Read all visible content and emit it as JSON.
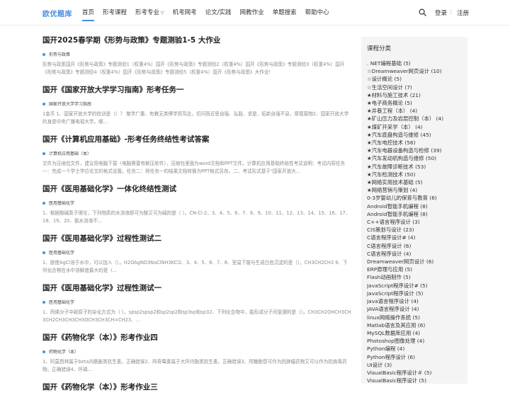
{
  "header": {
    "logo": "欧优题库",
    "nav": [
      {
        "label": "首页",
        "active": true,
        "caret": false
      },
      {
        "label": "形考课程",
        "active": false,
        "caret": false
      },
      {
        "label": "形考专业",
        "active": false,
        "caret": true
      },
      {
        "label": "机考网考",
        "active": false,
        "caret": false
      },
      {
        "label": "论文/实践",
        "active": false,
        "caret": false
      },
      {
        "label": "网教作业",
        "active": false,
        "caret": false
      },
      {
        "label": "单题搜索",
        "active": false,
        "caret": false
      },
      {
        "label": "帮助中心",
        "active": false,
        "caret": false
      }
    ],
    "login": "登录",
    "separator": "|",
    "register": "注册",
    "accent_color": "#4a8de0"
  },
  "articles": [
    {
      "title": "国开2025春学期《形势与政策》专题测验1-5 大作业",
      "category": "形势与政策",
      "excerpt": "形势与政策国开《形势与政策》专题测验1（权重4%）国开《形势与政策》专题测验2（权重4%）国开《形势与政策》专题测验3（权重4%）国开《形势与政策》专题测验4（权重4%）国开《形势与政策》专题测验5（权重4%）国开《形势与政策》大作业!"
    },
    {
      "title": "国开《国家开放大学学习指南》形考任务一",
      "category": "国家开放大学学习指南",
      "excerpt": "1金币 1、国家开放大学的校训是（）？ 敬学广惠、有教无类博学而笃志，切问而近思自强、弘毅、求是、拓新自强不息，厚德载物2、国家开放大学的身是中央广播电视大学。哪..."
    },
    {
      "title": "国开《计算机应用基础》-形考任务终结性考试答案",
      "category": "计算机应用基础（本）",
      "excerpt": "文件为压缩包文件，建议用电脑下载（电脑需要有解压软件），压缩包里面为word文档和PPT文件。计算机应用基础终结性考试说明：考试内容任务一：完成一个学士学位论文的格式设置。任务二：将任务一的结果文档转换为PPT格式另存。二、考试形式基于\"国家开放大..."
    },
    {
      "title": "国开《医用基础化学》一体化终结性测试",
      "category": "医用基础化学",
      "excerpt": "1、根据酸碱质子理论，下列物质的水溶液即可为酸又可为碱的是（ ）。CN-Cl-2、3、4、5、6、7、8、9、10、11、12、13、14、15、16、17、18、19、20、氨水溶液不..."
    },
    {
      "title": "国开《医用基础化学》过程性测试二",
      "category": "医用基础化学",
      "excerpt": "1、欲使AgCl溶于水中，可以加入（）。H2OAgNO3NaClNH3KCl2、3、4、5、6、7、8、室温下能与生成白色沉淀的是（）。CH3CH2CH3 9、下列化合物在水中溶解度最大的是（..."
    },
    {
      "title": "国开《医用基础化学》过程性测试一",
      "category": "医用基础化学",
      "excerpt": "1、丙烯分子中碳原子的杂化方式为（ ）。spsp2spsp2和sp2sp2和sp3sp和sp32、下列化合物中，能形成分子间氢键的是（）。CH3CH2OHCH3CH3CH2CH3CH3CH3OCH3CH3CH=CH23、..."
    },
    {
      "title": "国开《药物化学（本）》形考作业四",
      "category": "药物化学（本）",
      "excerpt": "1、阿莫西林属于beta内酰胺类抗生素。正确错误2、阿奇霉素属于大环内酯类抗生素。正确错误3、阿糖胞苷可作为抗肿瘤药物又可以作为抗病毒药物。正确错误4、环磷..."
    },
    {
      "title": "国开《药物化学（本）》形考作业三",
      "category": "",
      "excerpt": ""
    }
  ],
  "sidebar": {
    "title": "课程分类",
    "items": [
      ". NET编程基础 (5)",
      "☆Dreamweaver网页设计 (10)",
      "☆设计概论 (5)",
      "☆生活空间设计 (7)",
      "★材料与施工技术 (21)",
      "★电子商务概论 (5)",
      "★井巷工程（本） (4)",
      "★矿山压力及岩层控制（本） (4)",
      "★煤矿开采学（本） (4)",
      "★汽车底盘构造与维修 (45)",
      "★汽车电控技术 (56)",
      "★汽车电器设备构造与检修 (39)",
      "★汽车发动机构造与维修 (50)",
      "★汽车故障诊断技术 (53)",
      "★汽车检测技术 (50)",
      "★网络实用技术基础 (5)",
      "★网络营销与策划 (4)",
      "0-3岁婴幼儿的保育与教育 (6)",
      "Android智能手机编程 (8)",
      "Android智能手机编程 (8)",
      "C++语言程序设计 (3)",
      "CIS策划与设计 (23)",
      "C语言程序设计# (4)",
      "C语言程序设计 (6)",
      "C语言程序设计 (4)",
      "Dreamweaver网页设计 (6)",
      "ERP原理与应用 (5)",
      "Flash动画制作 (5)",
      "JavaScript程序设计# (5)",
      "JavaScript程序设计 (5)",
      "Java语言程序设计 (4)",
      "JAVA语言程序设计 (4)",
      "linux网络操作系统 (5)",
      "Matlab语言及其应用 (6)",
      "MySQL数据库应用 (4)",
      "Photoshop图像处理 (4)",
      "Python编程 (4)",
      "Python程序设计 (6)",
      "UI设计 (3)",
      "VisualBasic程序设计＃ (5)",
      "VisualBasic程序设计 (5)"
    ]
  }
}
